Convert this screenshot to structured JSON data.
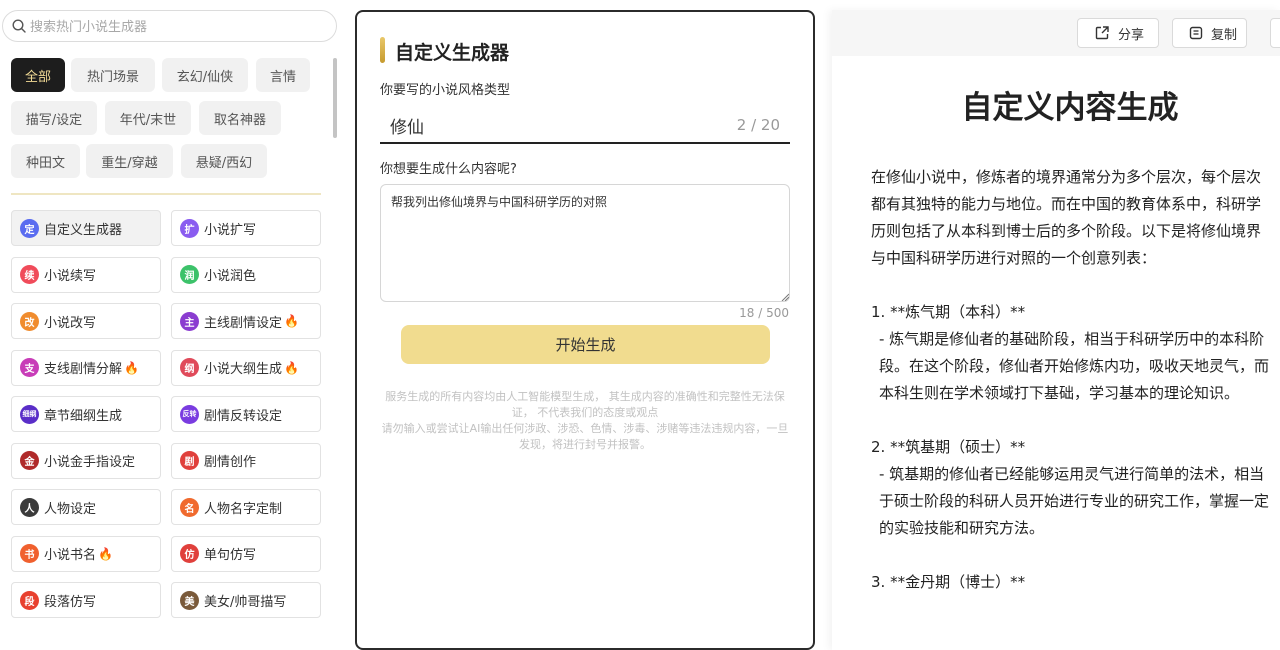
{
  "search": {
    "placeholder": "搜索热门小说生成器"
  },
  "categories": [
    {
      "label": "全部",
      "active": true
    },
    {
      "label": "热门场景"
    },
    {
      "label": "玄幻/仙侠"
    },
    {
      "label": "言情"
    },
    {
      "label": "描写/设定"
    },
    {
      "label": "年代/末世"
    },
    {
      "label": "取名神器"
    },
    {
      "label": "种田文"
    },
    {
      "label": "重生/穿越"
    },
    {
      "label": "悬疑/西幻"
    }
  ],
  "tools": [
    {
      "label": "自定义生成器",
      "icon": "定",
      "color": "#5a6cf0",
      "hot": false,
      "active": true
    },
    {
      "label": "小说扩写",
      "icon": "扩",
      "color": "#8a5cf0",
      "hot": false
    },
    {
      "label": "小说续写",
      "icon": "续",
      "color": "#f04b5a",
      "hot": false
    },
    {
      "label": "小说润色",
      "icon": "润",
      "color": "#3cc26a",
      "hot": false
    },
    {
      "label": "小说改写",
      "icon": "改",
      "color": "#f08c2e",
      "hot": false
    },
    {
      "label": "主线剧情设定",
      "icon": "主",
      "color": "#8a3cd0",
      "hot": true
    },
    {
      "label": "支线剧情分解",
      "icon": "支",
      "color": "#c83cb8",
      "hot": true
    },
    {
      "label": "小说大纲生成",
      "icon": "纲",
      "color": "#e04a5a",
      "hot": true
    },
    {
      "label": "章节细纲生成",
      "icon": "细纲",
      "color": "#5a2ec8",
      "hot": false
    },
    {
      "label": "剧情反转设定",
      "icon": "反转",
      "color": "#7a3ce0",
      "hot": false
    },
    {
      "label": "小说金手指设定",
      "icon": "金",
      "color": "#b02a2a",
      "hot": false
    },
    {
      "label": "剧情创作",
      "icon": "剧",
      "color": "#e0403c",
      "hot": false
    },
    {
      "label": "人物设定",
      "icon": "人",
      "color": "#3a3a3a",
      "hot": false
    },
    {
      "label": "人物名字定制",
      "icon": "名",
      "color": "#f06a2e",
      "hot": false
    },
    {
      "label": "小说书名",
      "icon": "书",
      "color": "#f0602e",
      "hot": true
    },
    {
      "label": "单句仿写",
      "icon": "仿",
      "color": "#e0403c",
      "hot": false
    },
    {
      "label": "段落仿写",
      "icon": "段",
      "color": "#e8402e",
      "hot": false
    },
    {
      "label": "美女/帅哥描写",
      "icon": "美",
      "color": "#7a5a3a",
      "hot": false
    }
  ],
  "generator": {
    "title": "自定义生成器",
    "style_label": "你要写的小说风格类型",
    "style_value": "修仙",
    "style_count": "2 / 20",
    "content_label": "你想要生成什么内容呢?",
    "content_value": "帮我列出修仙境界与中国科研学历的对照",
    "content_count": "18 / 500",
    "button": "开始生成",
    "disclaimer_1": "服务生成的所有内容均由人工智能模型生成， 其生成内容的准确性和完整性无法保证， 不代表我们的态度或观点",
    "disclaimer_2": "请勿输入或尝试让AI输出任何涉政、涉恐、色情、涉毒、涉赌等违法违规内容，一旦发现，将进行封号并报警。"
  },
  "result": {
    "share": "分享",
    "copy": "复制",
    "title": "自定义内容生成",
    "intro": "在修仙小说中，修炼者的境界通常分为多个层次，每个层次都有其独特的能力与地位。而在中国的教育体系中，科研学历则包括了从本科到博士后的多个阶段。以下是将修仙境界与中国科研学历进行对照的一个创意列表：",
    "item1_title": "1. **炼气期（本科）**",
    "item1_desc": "- 炼气期是修仙者的基础阶段，相当于科研学历中的本科阶段。在这个阶段，修仙者开始修炼内功，吸收天地灵气，而本科生则在学术领域打下基础，学习基本的理论知识。",
    "item2_title": "2. **筑基期（硕士）**",
    "item2_desc": "- 筑基期的修仙者已经能够运用灵气进行简单的法术，相当于硕士阶段的科研人员开始进行专业的研究工作，掌握一定的实验技能和研究方法。",
    "item3_title": "3. **金丹期（博士）**"
  }
}
